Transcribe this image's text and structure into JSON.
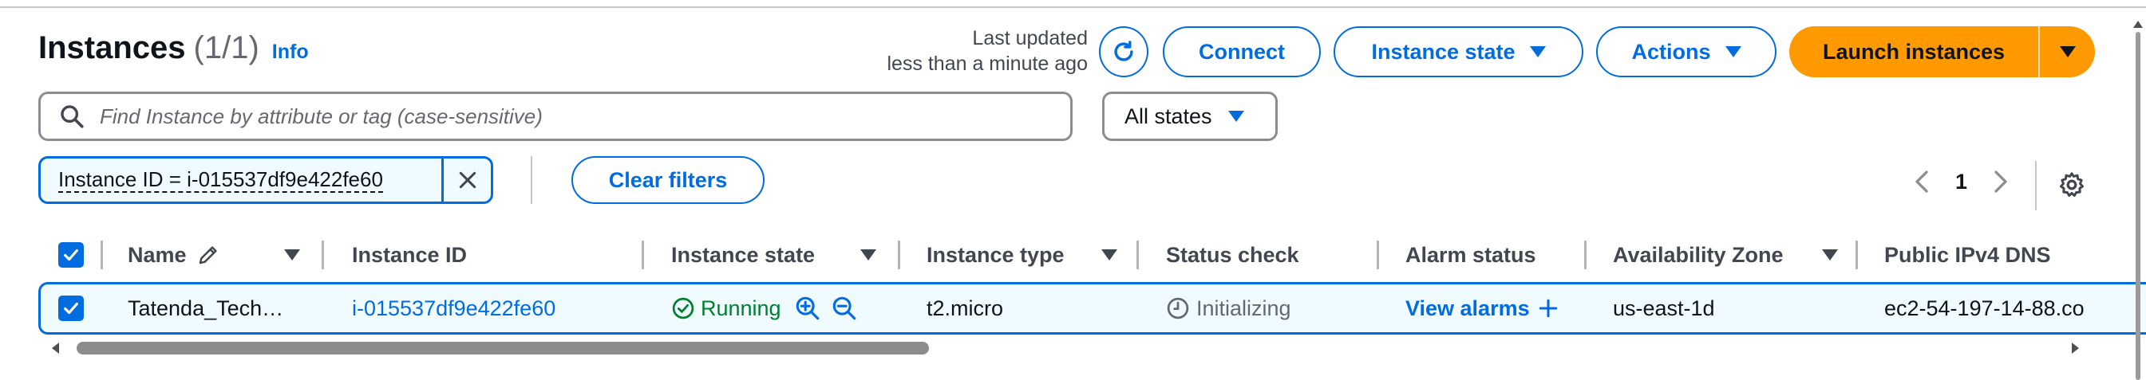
{
  "header": {
    "title": "Instances",
    "count": "(1/1)",
    "info": "Info",
    "last_updated_line1": "Last updated",
    "last_updated_line2": "less than a minute ago"
  },
  "toolbar": {
    "connect": "Connect",
    "instance_state": "Instance state",
    "actions": "Actions",
    "launch": "Launch instances"
  },
  "filter": {
    "search_placeholder": "Find Instance by attribute or tag (case-sensitive)",
    "state_select": "All states",
    "token": "Instance ID = i-015537df9e422fe60",
    "clear": "Clear filters"
  },
  "pagination": {
    "page": "1"
  },
  "table": {
    "columns": [
      "Name",
      "Instance ID",
      "Instance state",
      "Instance type",
      "Status check",
      "Alarm status",
      "Availability Zone",
      "Public IPv4 DNS"
    ],
    "rows": [
      {
        "name": "Tatenda_Tech…",
        "instance_id": "i-015537df9e422fe60",
        "state": "Running",
        "type": "t2.micro",
        "status_check": "Initializing",
        "alarm": "View alarms",
        "az": "us-east-1d",
        "dns": "ec2-54-197-14-88.co"
      }
    ]
  },
  "colors": {
    "accent": "#006ce0",
    "launch": "#ff9900",
    "success": "#00802f"
  }
}
